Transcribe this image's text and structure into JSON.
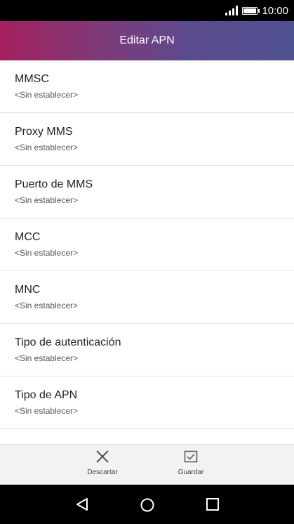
{
  "status_bar": {
    "time": "10:00"
  },
  "header": {
    "title": "Editar APN"
  },
  "settings": [
    {
      "label": "MMSC",
      "value": "<Sin establecer>"
    },
    {
      "label": "Proxy MMS",
      "value": "<Sin establecer>"
    },
    {
      "label": "Puerto de MMS",
      "value": "<Sin establecer>"
    },
    {
      "label": "MCC",
      "value": "<Sin establecer>"
    },
    {
      "label": "MNC",
      "value": "<Sin establecer>"
    },
    {
      "label": "Tipo de autenticación",
      "value": "<Sin establecer>"
    },
    {
      "label": "Tipo de APN",
      "value": "<Sin establecer>"
    }
  ],
  "actions": {
    "discard_label": "Descartar",
    "save_label": "Guardar"
  },
  "icons": {
    "discard": "close-icon",
    "save": "checkbox-check-icon",
    "back": "triangle-back-icon",
    "home": "circle-home-icon",
    "recents": "square-recents-icon"
  }
}
